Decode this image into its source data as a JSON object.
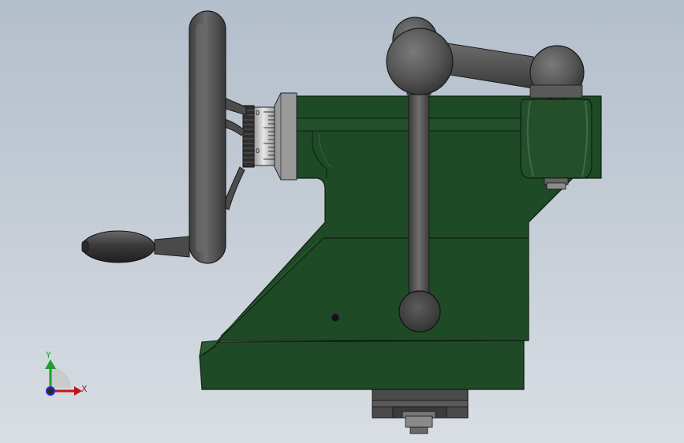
{
  "triad": {
    "x_label": "X",
    "y_label": "Y",
    "x_color": "#c0151b",
    "y_color": "#1e9e2a",
    "z_color": "#2a2ad0"
  },
  "dial": {
    "marks": [
      "0",
      "0"
    ]
  },
  "colors": {
    "body": "#1f4a26",
    "body_shadow": "#173a1d",
    "metal": "#4a4a4a",
    "metal_light": "#6b6b6b"
  }
}
